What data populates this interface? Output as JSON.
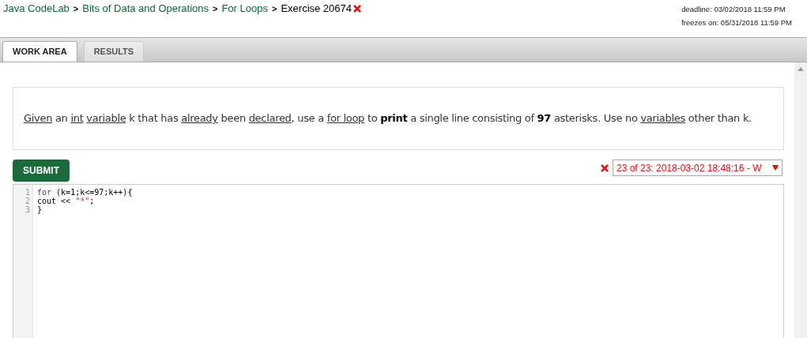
{
  "breadcrumb": [
    {
      "label": "Java CodeLab",
      "kind": "link"
    },
    {
      "label": "Bits of Data and Operations",
      "kind": "link"
    },
    {
      "label": "For Loops",
      "kind": "link"
    },
    {
      "label": "Exercise 20674",
      "kind": "current"
    }
  ],
  "separator": ">",
  "deadline": "deadline: 03/02/2018 11:59 PM",
  "freezes": "freezes on: 05/31/2018 11:59 PM",
  "tabs": [
    {
      "label": "WORK AREA",
      "selected": true
    },
    {
      "label": "RESULTS",
      "selected": false
    }
  ],
  "instructions": [
    {
      "text": "Given",
      "kind": "link"
    },
    {
      "text": " an ",
      "kind": "text"
    },
    {
      "text": "int",
      "kind": "link"
    },
    {
      "text": "variable",
      "kind": "link"
    },
    {
      "text": " k that has ",
      "kind": "text"
    },
    {
      "text": "already",
      "kind": "link"
    },
    {
      "text": " been ",
      "kind": "text"
    },
    {
      "text": "declared",
      "kind": "link"
    },
    {
      "text": ", use a ",
      "kind": "text"
    },
    {
      "text": "for loop",
      "kind": "link"
    },
    {
      "text": " to ",
      "kind": "text"
    },
    {
      "text": "print",
      "kind": "bold"
    },
    {
      "text": " a single line consisting of ",
      "kind": "text"
    },
    {
      "text": "97",
      "kind": "bold"
    },
    {
      "text": " asterisks. Use no ",
      "kind": "text"
    },
    {
      "text": "variables",
      "kind": "link"
    },
    {
      "text": " other than k.",
      "kind": "text"
    }
  ],
  "submit": "SUBMIT",
  "submission": {
    "correct": false,
    "value": "23 of 23: 2018-03-02 18:48:16 - W"
  },
  "code_lines": [
    {
      "number": "1",
      "tokens": [
        {
          "text": "for",
          "kind": "keyword"
        },
        {
          "text": " (k=1;k<=97;k++){",
          "kind": "plain"
        }
      ]
    },
    {
      "number": "2",
      "tokens": [
        {
          "text": "cout << ",
          "kind": "plain"
        },
        {
          "text": "\"*\"",
          "kind": "string"
        },
        {
          "text": ";",
          "kind": "plain"
        }
      ]
    },
    {
      "number": "3",
      "tokens": [
        {
          "text": "}",
          "kind": "plain"
        }
      ]
    }
  ]
}
